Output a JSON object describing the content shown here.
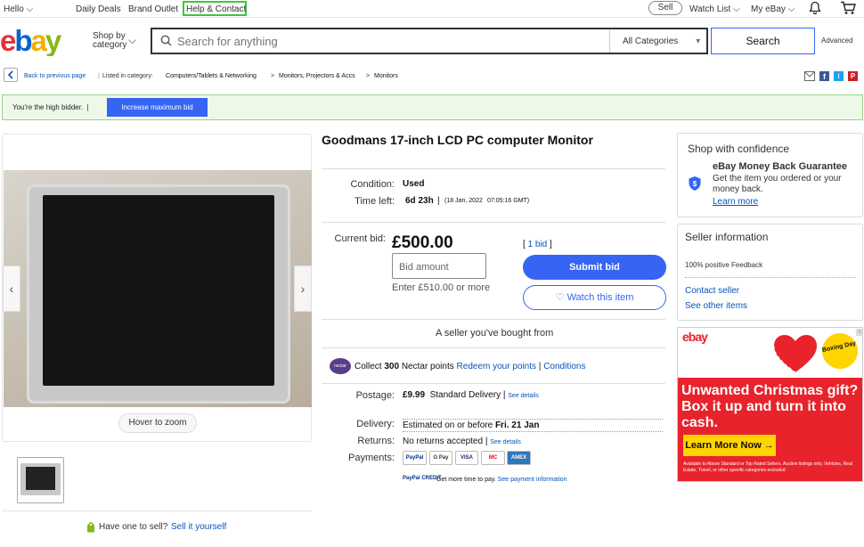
{
  "topbar": {
    "hello": "Hello",
    "daily_deals": "Daily Deals",
    "brand_outlet": "Brand Outlet",
    "help_contact": "Help & Contact",
    "sell": "Sell",
    "watch_list": "Watch List",
    "my_ebay": "My eBay"
  },
  "header": {
    "logo": "ebay",
    "shop_by": "Shop by",
    "category": "category",
    "search_placeholder": "Search for anything",
    "all_categories": "All Categories",
    "search_button": "Search",
    "advanced": "Advanced"
  },
  "breadcrumb": {
    "back": "Back to previous page",
    "listed_in": "Listed in category:",
    "items": [
      "Computers/Tablets & Networking",
      "Monitors, Projectors & Accs",
      "Monitors"
    ],
    "separator": ">"
  },
  "banner": {
    "text": "You're the high bidder.",
    "button": "Increase maximum bid"
  },
  "gallery": {
    "hover_zoom": "Hover to zoom"
  },
  "listing": {
    "title": "Goodmans 17-inch LCD PC computer Monitor",
    "condition_label": "Condition:",
    "condition_value": "Used",
    "time_left_label": "Time left:",
    "time_left_value": "6d 23h",
    "end_date": "(18 Jan, 2022",
    "end_time": "07:05:16 GMT)",
    "current_bid_label": "Current bid:",
    "price": "£500.00",
    "bid_count": "1 bid",
    "bid_placeholder": "Bid amount",
    "enter_hint": "Enter £510.00 or more",
    "submit_bid": "Submit bid",
    "watch_item": "Watch this item",
    "seller_note": "A seller you've bought from"
  },
  "nectar": {
    "logo": "nectar",
    "collect": "Collect",
    "points": "300",
    "nectar_points": "Nectar points",
    "redeem": "Redeem your points",
    "conditions": "Conditions"
  },
  "shipping": {
    "postage_label": "Postage:",
    "postage_price": "£9.99",
    "postage_method": "Standard Delivery",
    "see_details": "See details",
    "delivery_label": "Delivery:",
    "delivery_text": "Estimated on or before",
    "delivery_date": "Fri. 21 Jan",
    "returns_label": "Returns:",
    "returns_text": "No returns accepted",
    "payments_label": "Payments:",
    "payment_methods": [
      "PayPal",
      "G Pay",
      "VISA",
      "MC",
      "AMEX"
    ],
    "paypal_credit": "PayPal CREDIT",
    "credit_text": "Get more time to pay.",
    "credit_link": "See payment information"
  },
  "confidence": {
    "title": "Shop with confidence",
    "guarantee_title": "eBay Money Back Guarantee",
    "guarantee_text": "Get the item you ordered or your money back.",
    "learn_more": "Learn more"
  },
  "seller": {
    "title": "Seller information",
    "feedback": "100% positive Feedback",
    "contact": "Contact seller",
    "other_items": "See other items"
  },
  "ad": {
    "logo": "ebay",
    "badge": "Boxing Day",
    "headline": "Unwanted Christmas gift? Box it up and turn it into cash.",
    "button": "Learn More Now →",
    "fine_print": "Available to Above Standard or Top Rated Sellers. Auction listings only. Vehicles, Real Estate, Travel, or other specific categories excluded"
  },
  "footer": {
    "have_one": "Have one to sell?",
    "sell_it": "Sell it yourself"
  },
  "colors": {
    "accent_blue": "#3665f3",
    "link_blue": "#0654ba",
    "banner_green": "#eef8e8",
    "ad_red": "#e8232b",
    "help_outline": "#3ac93a"
  }
}
